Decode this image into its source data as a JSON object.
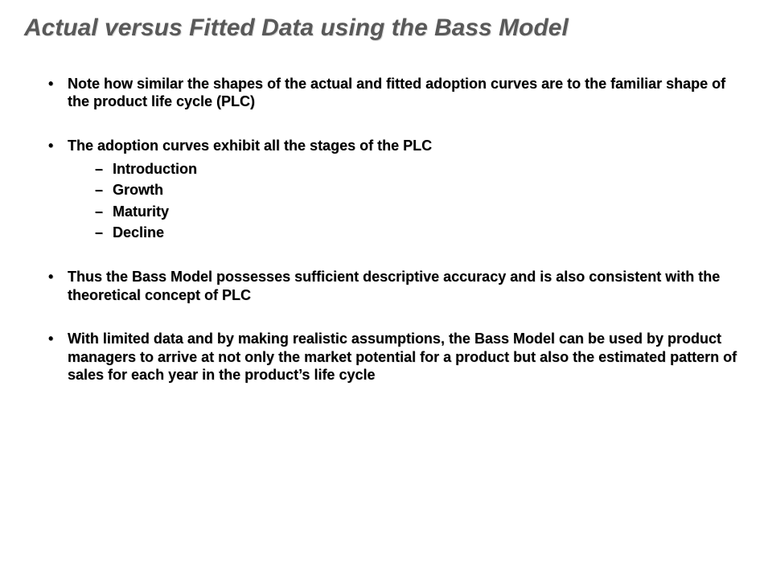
{
  "title": "Actual versus Fitted Data using the Bass Model",
  "bullets": {
    "b1": "Note how similar the shapes of the actual and fitted adoption curves are to the familiar shape of the product life cycle (PLC)",
    "b2": "The adoption curves exhibit all the stages of the PLC",
    "b2_sub": {
      "s1": "Introduction",
      "s2": "Growth",
      "s3": "Maturity",
      "s4": "Decline"
    },
    "b3": "Thus the Bass Model possesses sufficient descriptive accuracy and is also consistent with the theoretical concept of PLC",
    "b4": "With limited data and by making realistic assumptions, the Bass Model can be used by product managers to arrive at not only the market potential for a product  but also the estimated pattern of sales for each year in the product’s life cycle"
  }
}
